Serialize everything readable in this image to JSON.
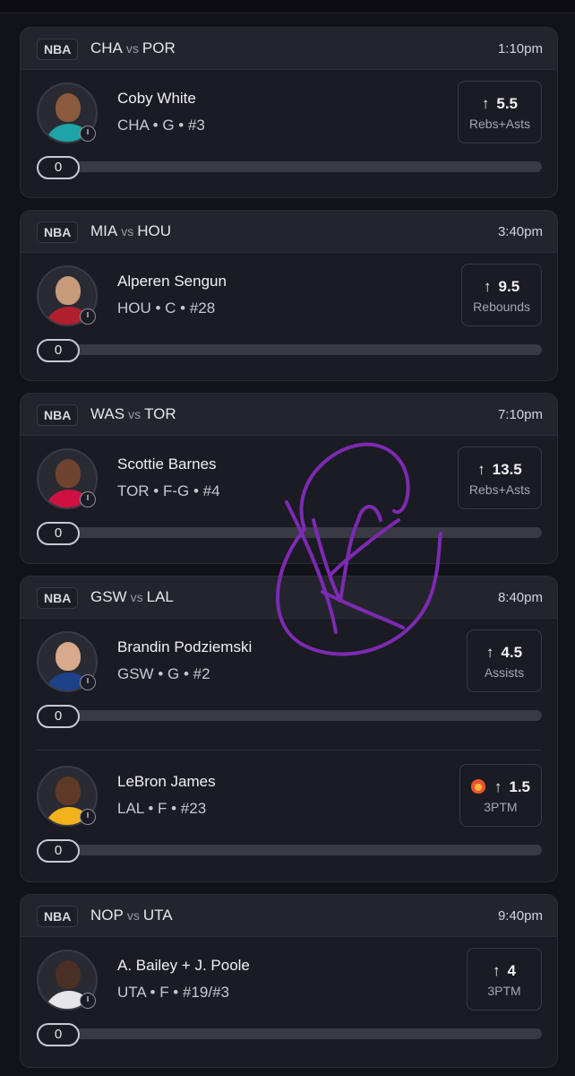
{
  "colors": {
    "background": "#121219",
    "card": "#1b1b23",
    "header": "#24242d",
    "scribble": "#7d2ab3",
    "fire": "#e8552b"
  },
  "cards": [
    {
      "league": "NBA",
      "team_a": "CHA",
      "vs": "vs",
      "team_b": "POR",
      "time": "1:10pm",
      "players": [
        {
          "name": "Coby White",
          "info": "CHA • G • #3",
          "arrow": "↑",
          "line": "5.5",
          "stat": "Rebs+Asts",
          "progress": "0",
          "progress_fraction": 0,
          "jersey_color": "#1ea3a8",
          "hot": false
        }
      ]
    },
    {
      "league": "NBA",
      "team_a": "MIA",
      "vs": "vs",
      "team_b": "HOU",
      "time": "3:40pm",
      "players": [
        {
          "name": "Alperen Sengun",
          "info": "HOU • C • #28",
          "arrow": "↑",
          "line": "9.5",
          "stat": "Rebounds",
          "progress": "0",
          "progress_fraction": 0,
          "jersey_color": "#b11f2e",
          "hot": false
        }
      ]
    },
    {
      "league": "NBA",
      "team_a": "WAS",
      "vs": "vs",
      "team_b": "TOR",
      "time": "7:10pm",
      "players": [
        {
          "name": "Scottie Barnes",
          "info": "TOR • F-G • #4",
          "arrow": "↑",
          "line": "13.5",
          "stat": "Rebs+Asts",
          "progress": "0",
          "progress_fraction": 0,
          "jersey_color": "#ce1141",
          "hot": false
        }
      ]
    },
    {
      "league": "NBA",
      "team_a": "GSW",
      "vs": "vs",
      "team_b": "LAL",
      "time": "8:40pm",
      "players": [
        {
          "name": "Brandin Podziemski",
          "info": "GSW • G • #2",
          "arrow": "↑",
          "line": "4.5",
          "stat": "Assists",
          "progress": "0",
          "progress_fraction": 0,
          "jersey_color": "#1d428a",
          "hot": false
        },
        {
          "name": "LeBron James",
          "info": "LAL • F • #23",
          "arrow": "↑",
          "line": "1.5",
          "stat": "3PTM",
          "progress": "0",
          "progress_fraction": 0,
          "jersey_color": "#f2b21b",
          "hot": true
        }
      ]
    },
    {
      "league": "NBA",
      "team_a": "NOP",
      "vs": "vs",
      "team_b": "UTA",
      "time": "9:40pm",
      "players": [
        {
          "name": "A. Bailey + J. Poole",
          "info": "UTA • F • #19/#3",
          "arrow": "↑",
          "line": "4",
          "stat": "3PTM",
          "progress": "0",
          "progress_fraction": 0,
          "jersey_color": "#e6e6ea",
          "hot": false
        }
      ]
    }
  ]
}
